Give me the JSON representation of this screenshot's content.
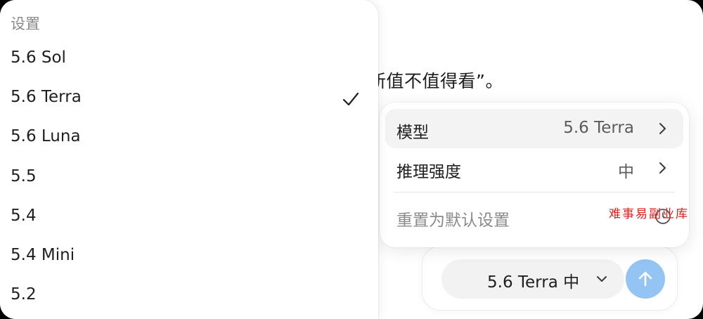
{
  "chat": {
    "message_fragment": "新值不值得看”。"
  },
  "model_menu": {
    "header": "设置",
    "items": [
      {
        "label": "5.6 Sol",
        "selected": false
      },
      {
        "label": "5.6 Terra",
        "selected": true
      },
      {
        "label": "5.6 Luna",
        "selected": false
      },
      {
        "label": "5.5",
        "selected": false
      },
      {
        "label": "5.4",
        "selected": false
      },
      {
        "label": "5.4 Mini",
        "selected": false
      },
      {
        "label": "5.2",
        "selected": false
      }
    ],
    "check_icon": "checkmark-icon"
  },
  "settings_popover": {
    "model_label": "模型",
    "model_value": "5.6 Terra",
    "reasoning_label": "推理强度",
    "reasoning_value": "中",
    "reset_label": "重置为默认设置",
    "chevron_icon": "chevron-right-icon",
    "reset_icon": "clock-reset-icon"
  },
  "composer": {
    "model_pill_label": "5.6 Terra 中",
    "pill_chevron_icon": "chevron-down-icon",
    "send_icon": "arrow-up-icon",
    "send_color": "#94c4f4"
  },
  "watermark": {
    "text": "难事易副业库"
  }
}
